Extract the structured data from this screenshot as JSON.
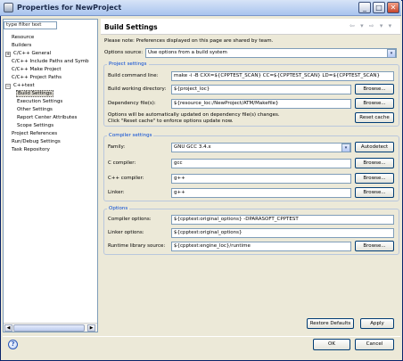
{
  "window": {
    "title": "Properties for NewProject"
  },
  "title_buttons": {
    "minimize": "_",
    "maximize": "□",
    "close": "✕"
  },
  "filter": {
    "value": "type filter text"
  },
  "tree": [
    {
      "label": "Resource",
      "expander": "",
      "level": 1
    },
    {
      "label": "Builders",
      "expander": "",
      "level": 1
    },
    {
      "label": "C/C++ General",
      "expander": "+",
      "level": 0
    },
    {
      "label": "C/C++ Include Paths and Symb",
      "expander": "",
      "level": 1
    },
    {
      "label": "C/C++ Make Project",
      "expander": "",
      "level": 1
    },
    {
      "label": "C/C++ Project Paths",
      "expander": "",
      "level": 1
    },
    {
      "label": "C++test",
      "expander": "−",
      "level": 0
    },
    {
      "label": "Build Settings",
      "expander": "",
      "level": 2,
      "selected": true
    },
    {
      "label": "Execution Settings",
      "expander": "",
      "level": 2
    },
    {
      "label": "Other Settings",
      "expander": "",
      "level": 2
    },
    {
      "label": "Report Center Attributes",
      "expander": "",
      "level": 2
    },
    {
      "label": "Scope Settings",
      "expander": "",
      "level": 2
    },
    {
      "label": "Project References",
      "expander": "",
      "level": 1
    },
    {
      "label": "Run/Debug Settings",
      "expander": "",
      "level": 1
    },
    {
      "label": "Task Repository",
      "expander": "",
      "level": 1
    }
  ],
  "scroll": {
    "left": "◀",
    "right": "▶"
  },
  "page": {
    "title": "Build Settings",
    "nav": "⇦ ▾ ⇨ ▾ ▾",
    "note": "Please note: Preferences displayed on this page are shared by team.",
    "options_source_label": "Options source:",
    "options_source_value": "Use options from a build system",
    "dropdown_glyph": "▾"
  },
  "project_settings": {
    "title": "Project settings",
    "build_command_label": "Build command line:",
    "build_command_value": "make -i -B CXX=${CPPTEST_SCAN} CC=${CPPTEST_SCAN} LD=${CPPTEST_SCAN}",
    "working_dir_label": "Build working directory:",
    "working_dir_value": "${project_loc}",
    "dependency_label": "Dependency file(s):",
    "dependency_value": "${resource_loc:/NewProject/ATM/Makefile}",
    "auto_update_note_1": "Options will be automatically updated on dependency file(s) changes.",
    "auto_update_note_2": "Click \"Reset cache\" to enforce options update now.",
    "reset_cache_label": "Reset cache"
  },
  "compiler_settings": {
    "title": "Compiler settings",
    "family_label": "Family:",
    "family_value": "GNU GCC 3.4.x",
    "autodetect_label": "Autodetect",
    "c_compiler_label": "C compiler:",
    "c_compiler_value": "gcc",
    "cpp_compiler_label": "C++ compiler:",
    "cpp_compiler_value": "g++",
    "linker_label": "Linker:",
    "linker_value": "g++"
  },
  "options": {
    "title": "Options",
    "compiler_options_label": "Compiler options:",
    "compiler_options_value": "${cpptest:original_options} -DPARASOFT_CPPTEST",
    "linker_options_label": "Linker options:",
    "linker_options_value": "${cpptest:original_options}",
    "runtime_label": "Runtime library source:",
    "runtime_value": "${cpptest:engine_loc}/runtime"
  },
  "buttons": {
    "browse": "Browse...",
    "restore_defaults": "Restore Defaults",
    "apply": "Apply",
    "ok": "OK",
    "cancel": "Cancel"
  },
  "help": {
    "glyph": "?"
  }
}
